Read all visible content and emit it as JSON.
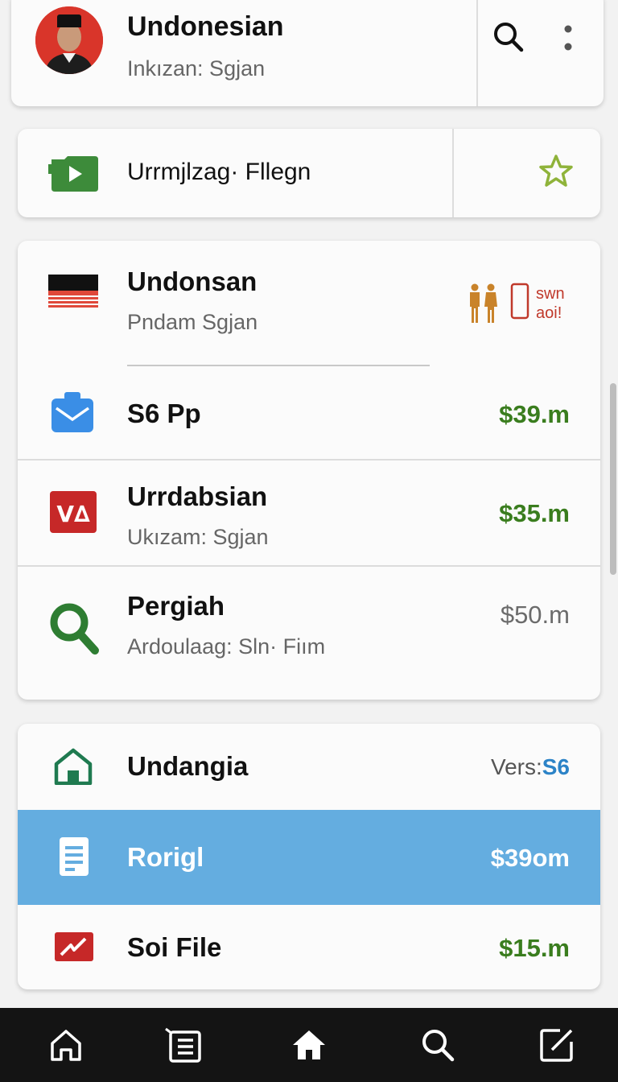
{
  "header": {
    "title": "Undonesian",
    "subtitle": "Inkızan: Sgjan",
    "avatar_icon": "person-avatar",
    "search_icon": "search-icon",
    "more_icon": "more-vert-icon"
  },
  "folder": {
    "label": "Urrmjlzag· Fllegn",
    "icon": "video-folder-icon",
    "star_icon": "star-outline-icon"
  },
  "main": {
    "items": [
      {
        "title": "Undonsan",
        "subtitle": "Pndam Sgjan",
        "badge": "swn\naoi!",
        "icon": "flag-icon"
      },
      {
        "title": "S6 Pp",
        "value": "$39.m",
        "icon": "mail-box-icon"
      },
      {
        "title": "Urrdabsian",
        "subtitle": "Ukızam: Sgjan",
        "value": "$35.m",
        "icon": "va-logo-icon"
      },
      {
        "title": "Pergiah",
        "subtitle": "Ardoulaag: Sln· Fiım",
        "value": "$50.m",
        "icon": "magnifier-icon"
      }
    ]
  },
  "bottom": {
    "items": [
      {
        "title": "Undangia",
        "value_prefix": "Vers:",
        "value_suffix": "S6",
        "icon": "house-icon"
      },
      {
        "title": "Rorigl",
        "value": "$39om",
        "icon": "document-icon",
        "selected": true
      },
      {
        "title": "Soi File",
        "value": "$15.m",
        "icon": "chart-card-icon"
      }
    ]
  },
  "nav": [
    "home-outline-icon",
    "list-icon",
    "home-filled-icon",
    "search-icon",
    "edit-icon"
  ],
  "colors": {
    "accent_green": "#3a7d1e",
    "selected_blue": "#64ade0",
    "avatar_red": "#d9352a",
    "folder_green": "#3d8b3a",
    "nav_bg": "#141414"
  }
}
